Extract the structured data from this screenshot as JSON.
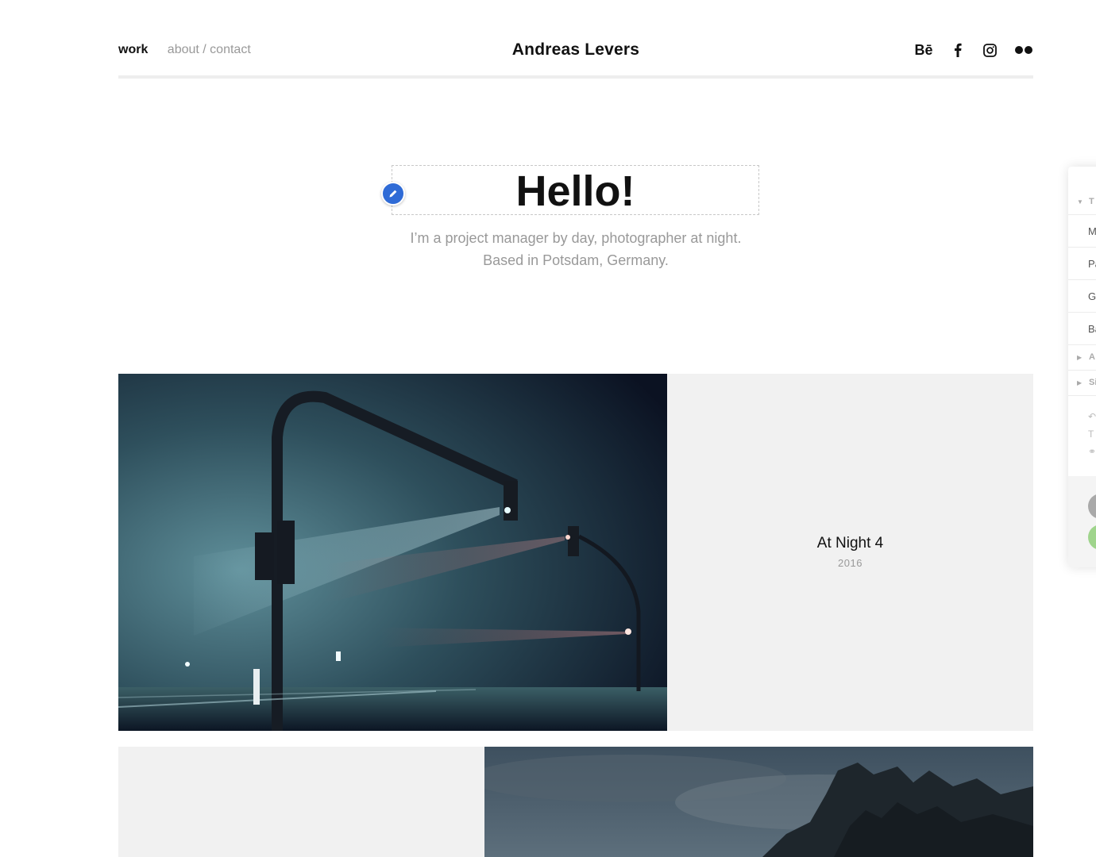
{
  "header": {
    "nav": {
      "work": "work",
      "about": "about / contact"
    },
    "site_title": "Andreas Levers",
    "social": [
      {
        "name": "behance-icon",
        "glyph": "Bē"
      },
      {
        "name": "facebook-icon",
        "glyph": "f"
      },
      {
        "name": "instagram-icon",
        "glyph": ""
      },
      {
        "name": "flickr-icon",
        "glyph": ""
      }
    ]
  },
  "hero": {
    "title": "Hello!",
    "line1": "I’m a project manager by day, photographer at night.",
    "line2": "Based in Potsdam, Germany."
  },
  "projects": [
    {
      "title": "At Night 4",
      "year": "2016"
    },
    {
      "title": "",
      "year": ""
    }
  ],
  "side_panel": {
    "section_open": "T",
    "rows": [
      "M",
      "Pa",
      "G",
      "Ba"
    ],
    "sections_closed": [
      "A",
      "Si"
    ]
  },
  "colors": {
    "accent": "#2f6bd6",
    "muted": "#999999",
    "info_bg": "#f1f1f1"
  }
}
